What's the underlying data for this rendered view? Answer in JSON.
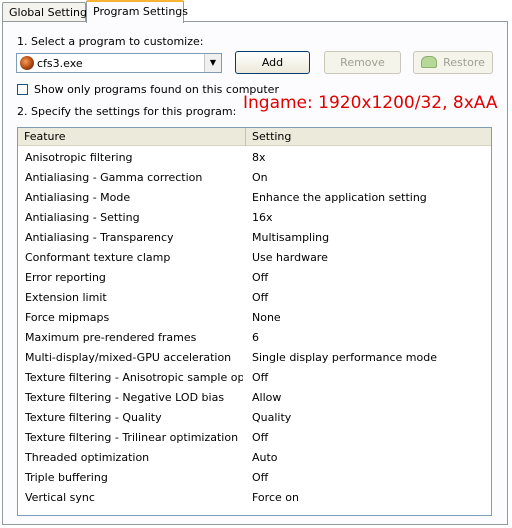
{
  "tabs": [
    {
      "label": "Global Settings",
      "active": false
    },
    {
      "label": "Program Settings",
      "active": true
    }
  ],
  "step1_label": "1. Select a program to customize:",
  "program_select": {
    "value": "cfs3.exe"
  },
  "buttons": {
    "add": "Add",
    "remove": "Remove",
    "restore": "Restore"
  },
  "show_only_checkbox": {
    "label": "Show only programs found on this computer",
    "checked": false
  },
  "step2_label": "2. Specify the settings for this program:",
  "annotation": {
    "text": "Ingame: 1920x1200/32, 8xAA",
    "color": "#e00000"
  },
  "table": {
    "headers": [
      "Feature",
      "Setting"
    ],
    "rows": [
      {
        "feature": "Anisotropic filtering",
        "setting": "8x"
      },
      {
        "feature": "Antialiasing - Gamma correction",
        "setting": "On"
      },
      {
        "feature": "Antialiasing - Mode",
        "setting": "Enhance the application setting"
      },
      {
        "feature": "Antialiasing - Setting",
        "setting": "16x"
      },
      {
        "feature": "Antialiasing - Transparency",
        "setting": "Multisampling"
      },
      {
        "feature": "Conformant texture clamp",
        "setting": "Use hardware"
      },
      {
        "feature": "Error reporting",
        "setting": "Off"
      },
      {
        "feature": "Extension limit",
        "setting": "Off"
      },
      {
        "feature": "Force mipmaps",
        "setting": "None"
      },
      {
        "feature": "Maximum pre-rendered frames",
        "setting": "6"
      },
      {
        "feature": "Multi-display/mixed-GPU acceleration",
        "setting": "Single display performance mode"
      },
      {
        "feature": "Texture filtering - Anisotropic sample opti...",
        "setting": "Off"
      },
      {
        "feature": "Texture filtering - Negative LOD bias",
        "setting": "Allow"
      },
      {
        "feature": "Texture filtering - Quality",
        "setting": "Quality"
      },
      {
        "feature": "Texture filtering - Trilinear optimization",
        "setting": "Off"
      },
      {
        "feature": "Threaded optimization",
        "setting": "Auto"
      },
      {
        "feature": "Triple buffering",
        "setting": "Off"
      },
      {
        "feature": "Vertical sync",
        "setting": "Force on"
      }
    ]
  }
}
